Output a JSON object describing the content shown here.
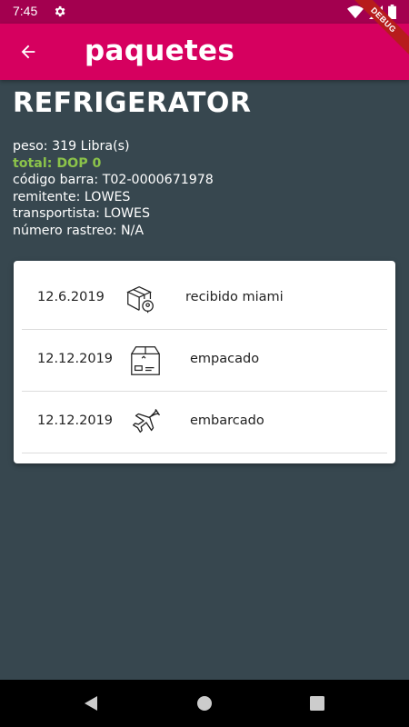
{
  "status_bar": {
    "time": "7:45",
    "icons": [
      "settings-icon",
      "wifi-icon",
      "signal-icon",
      "battery-icon"
    ]
  },
  "app_bar": {
    "title": "paquetes",
    "back_icon": "arrow-back-icon",
    "color": "#d6005f"
  },
  "debug_banner": "DEBUG",
  "package": {
    "name": "REFRIGERATOR",
    "peso": "peso: 319 Libra(s)",
    "total": "total: DOP 0",
    "codigo_barra": "código barra: T02-0000671978",
    "remitente": "remitente: LOWES",
    "transportista": "transportista: LOWES",
    "numero_rastreo": "número rastreo: N/A"
  },
  "timeline": [
    {
      "date": "12.6.2019",
      "icon": "package-location-icon",
      "status": "recibido miami"
    },
    {
      "date": "12.12.2019",
      "icon": "box-icon",
      "status": "empacado"
    },
    {
      "date": "12.12.2019",
      "icon": "airplane-icon",
      "status": "embarcado"
    }
  ],
  "nav_bar": {
    "icons": [
      "back-triangle-icon",
      "home-circle-icon",
      "recents-square-icon"
    ]
  },
  "colors": {
    "background": "#37474f",
    "accent": "#d6005f",
    "status_bar": "#a3004f",
    "total_green": "#8bc34a"
  }
}
